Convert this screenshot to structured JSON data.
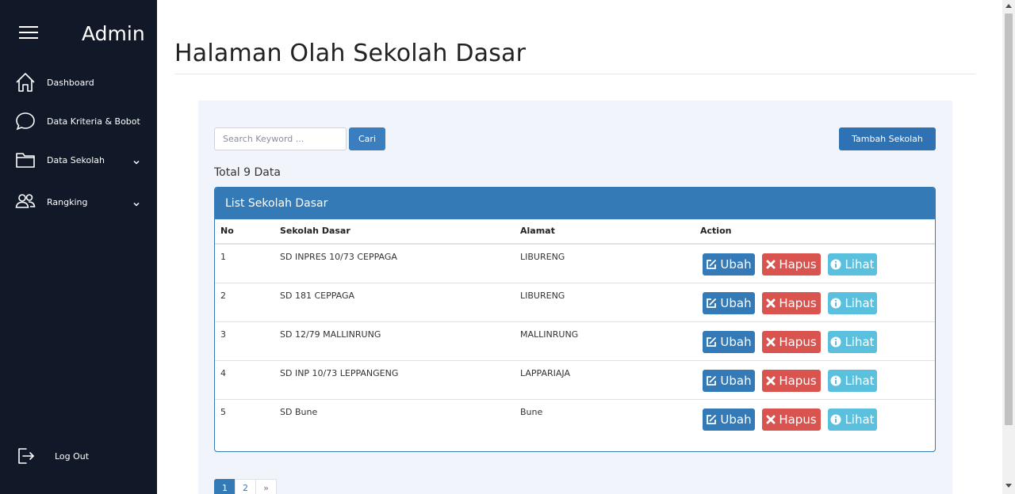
{
  "sidebar": {
    "brand": "Admin",
    "items": [
      {
        "label": "Dashboard",
        "icon": "home-icon"
      },
      {
        "label": "Data Kriteria & Bobot",
        "icon": "chat-icon"
      },
      {
        "label": "Data Sekolah",
        "icon": "folder-icon",
        "has_submenu": true
      },
      {
        "label": "Rangking",
        "icon": "users-icon",
        "has_submenu": true
      }
    ],
    "logout_label": "Log Out"
  },
  "page": {
    "title": "Halaman Olah Sekolah Dasar"
  },
  "toolbar": {
    "search_placeholder": "Search Keyword ...",
    "search_value": "",
    "search_button": "Cari",
    "add_button": "Tambah Sekolah"
  },
  "summary": {
    "total_text": "Total 9 Data"
  },
  "table": {
    "title": "List Sekolah Dasar",
    "columns": [
      "No",
      "Sekolah Dasar",
      "Alamat",
      "Action"
    ],
    "rows": [
      {
        "no": "1",
        "sekolah": "SD INPRES 10/73 CEPPAGA",
        "alamat": "LIBURENG"
      },
      {
        "no": "2",
        "sekolah": "SD 181 CEPPAGA",
        "alamat": "LIBURENG"
      },
      {
        "no": "3",
        "sekolah": "SD 12/79 MALLINRUNG",
        "alamat": "MALLINRUNG"
      },
      {
        "no": "4",
        "sekolah": "SD INP 10/73 LEPPANGENG",
        "alamat": "LAPPARIAJA"
      },
      {
        "no": "5",
        "sekolah": "SD Bune",
        "alamat": "Bune"
      }
    ],
    "actions": {
      "edit": "Ubah",
      "delete": "Hapus",
      "view": "Lihat"
    }
  },
  "pagination": {
    "pages": [
      "1",
      "2"
    ],
    "current": "1",
    "next": "»"
  },
  "colors": {
    "sidebar_bg": "#111827",
    "primary": "#337ab7",
    "danger": "#d9534f",
    "info": "#5bc0de",
    "panel_bg": "#f1f5fb"
  }
}
